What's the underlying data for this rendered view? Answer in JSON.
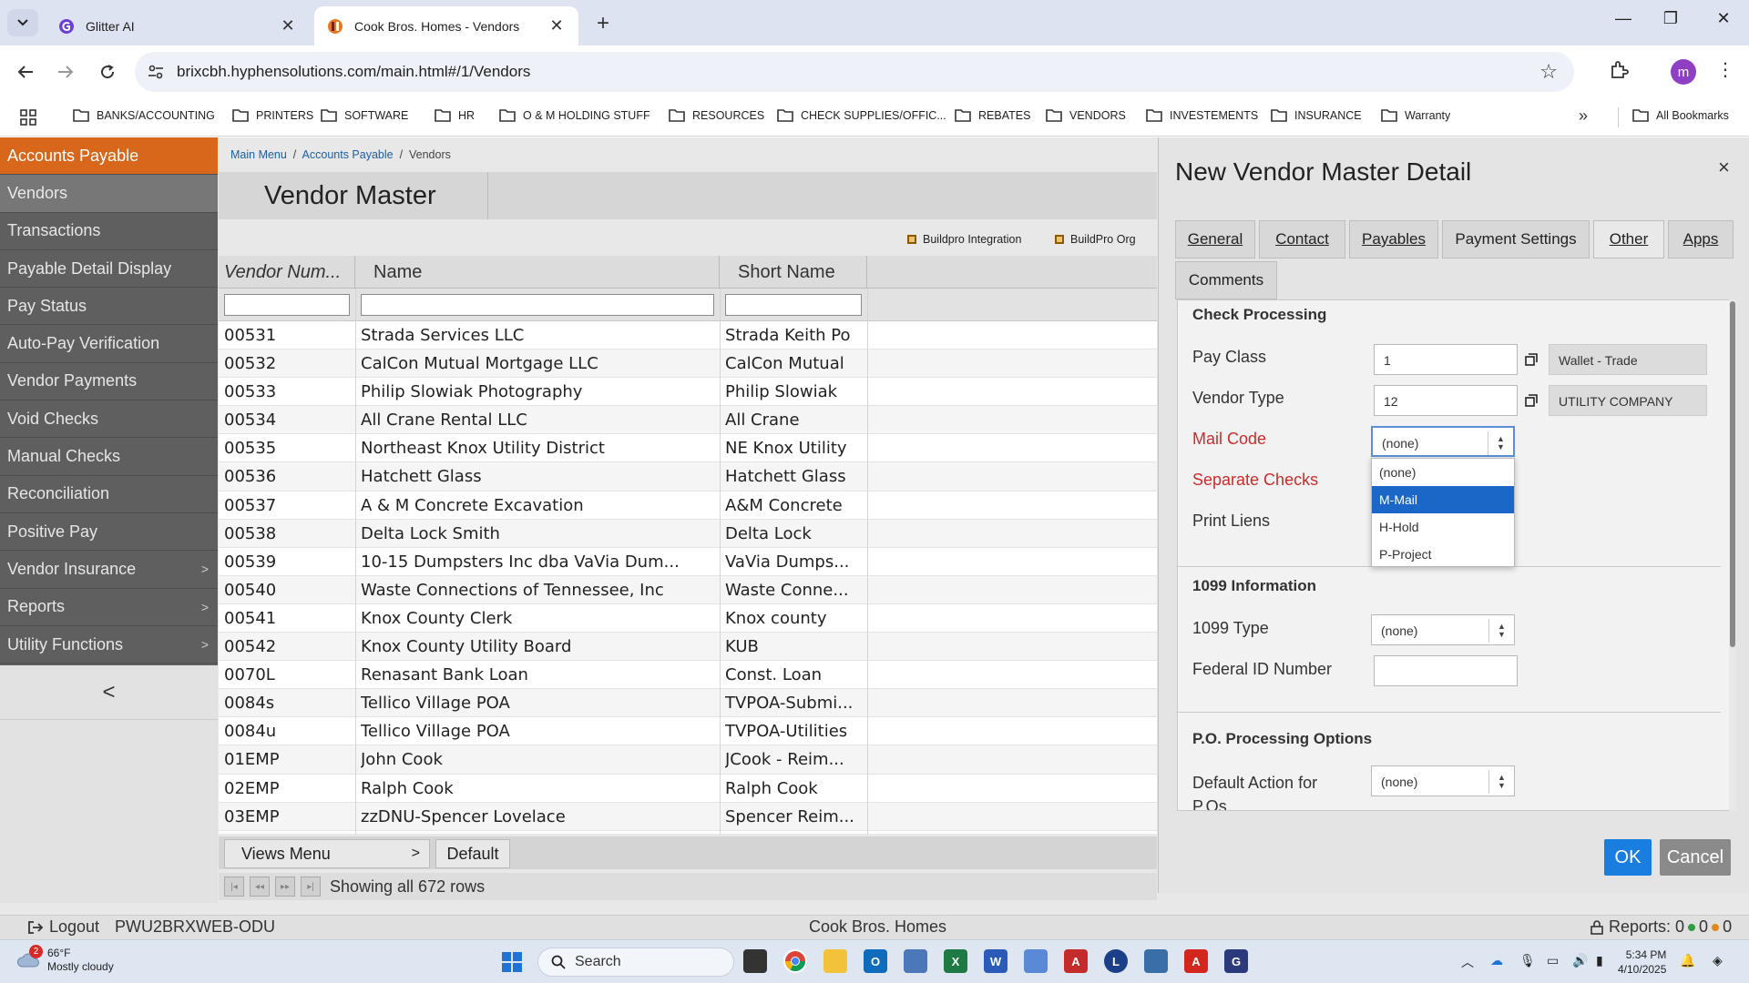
{
  "browser": {
    "tabs": [
      {
        "title": "Glitter AI",
        "active": false
      },
      {
        "title": "Cook Bros. Homes - Vendors",
        "active": true
      }
    ],
    "url": "brixcbh.hyphensolutions.com/main.html#/1/Vendors",
    "profile_initial": "m",
    "bookmarks": [
      "BANKS/ACCOUNTING",
      "PRINTERS",
      "SOFTWARE",
      "HR",
      "O & M HOLDING STUFF",
      "RESOURCES",
      "CHECK SUPPLIES/OFFIC...",
      "REBATES",
      "VENDORS",
      "INVESTEMENTS",
      "INSURANCE",
      "Warranty"
    ],
    "all_bookmarks": "All Bookmarks"
  },
  "sidebar": {
    "items": [
      {
        "label": "Accounts Payable",
        "state": "header"
      },
      {
        "label": "Vendors",
        "state": "selected"
      },
      {
        "label": "Transactions"
      },
      {
        "label": "Payable Detail Display"
      },
      {
        "label": "Pay Status"
      },
      {
        "label": "Auto-Pay Verification"
      },
      {
        "label": "Vendor Payments"
      },
      {
        "label": "Void Checks"
      },
      {
        "label": "Manual Checks"
      },
      {
        "label": "Reconciliation"
      },
      {
        "label": "Positive Pay"
      },
      {
        "label": "Vendor Insurance",
        "submenu": true
      },
      {
        "label": "Reports",
        "submenu": true
      },
      {
        "label": "Utility Functions",
        "submenu": true
      }
    ],
    "collapse_symbol": "<"
  },
  "breadcrumb": {
    "main_menu": "Main Menu",
    "accounts_payable": "Accounts Payable",
    "current": "Vendors",
    "sep": "/"
  },
  "page_title": "Vendor Master",
  "filters": {
    "buildpro_integration": "Buildpro Integration",
    "buildpro_org": "BuildPro Org"
  },
  "grid": {
    "columns": [
      "Vendor Num...",
      "Name",
      "Short Name"
    ],
    "rows": [
      [
        "00531",
        "Strada Services LLC",
        "Strada Keith Po"
      ],
      [
        "00532",
        "CalCon Mutual Mortgage LLC",
        "CalCon Mutual"
      ],
      [
        "00533",
        "Philip Slowiak Photography",
        "Philip Slowiak"
      ],
      [
        "00534",
        "All Crane Rental LLC",
        "All Crane"
      ],
      [
        "00535",
        "Northeast Knox Utility District",
        "NE Knox Utility"
      ],
      [
        "00536",
        "Hatchett Glass",
        "Hatchett Glass"
      ],
      [
        "00537",
        "A & M Concrete Excavation",
        "A&M Concrete"
      ],
      [
        "00538",
        "Delta Lock Smith",
        "Delta Lock"
      ],
      [
        "00539",
        "10-15 Dumpsters Inc dba VaVia Dum...",
        "VaVia Dumps..."
      ],
      [
        "00540",
        "Waste Connections of Tennessee, Inc",
        "Waste Conne..."
      ],
      [
        "00541",
        "Knox County Clerk",
        "Knox county"
      ],
      [
        "00542",
        "Knox County Utility Board",
        "KUB"
      ],
      [
        "0070L",
        "Renasant Bank Loan",
        "Const. Loan"
      ],
      [
        "0084s",
        "Tellico Village POA",
        "TVPOA-Submi..."
      ],
      [
        "0084u",
        "Tellico Village POA",
        "TVPOA-Utilities"
      ],
      [
        "01EMP",
        "John Cook",
        "JCook - Reim..."
      ],
      [
        "02EMP",
        "Ralph Cook",
        "Ralph Cook"
      ],
      [
        "03EMP",
        "zzDNU-Spencer Lovelace",
        "Spencer Reim..."
      ]
    ],
    "views_menu": "Views Menu",
    "default_view": "Default",
    "showing": "Showing all 672 rows"
  },
  "status": {
    "logout": "Logout",
    "server": "PWU2BRXWEB-ODU",
    "company": "Cook Bros. Homes",
    "reports": "Reports: 0",
    "reports_a": "0",
    "reports_b": "0",
    "colors": {
      "green": "#2e9e3e",
      "orange": "#e08a1e"
    }
  },
  "modal": {
    "title": "New Vendor Master Detail",
    "close": "×",
    "tabs": [
      "General",
      "Contact",
      "Payables",
      "Payment Settings",
      "Other",
      "Apps",
      "Comments"
    ],
    "active_tab": "Other",
    "check_processing": {
      "title": "Check Processing",
      "pay_class_label": "Pay Class",
      "pay_class_value": "1",
      "pay_class_desc": "Wallet - Trade",
      "vendor_type_label": "Vendor Type",
      "vendor_type_value": "12",
      "vendor_type_desc": "UTILITY COMPANY",
      "mail_code_label": "Mail Code",
      "mail_code_value": "(none)",
      "separate_checks_label": "Separate Checks",
      "print_liens_label": "Print Liens"
    },
    "mail_code_options": [
      "(none)",
      "M-Mail",
      "H-Hold",
      "P-Project"
    ],
    "mail_code_highlight": "M-Mail",
    "info_1099": {
      "title": "1099 Information",
      "type_label": "1099 Type",
      "type_value": "(none)",
      "fed_id_label": "Federal ID Number",
      "fed_id_value": ""
    },
    "po_options": {
      "title": "P.O. Processing Options",
      "default_action_label": "Default Action for P.Os",
      "default_action_value": "(none)"
    },
    "ok": "OK",
    "cancel": "Cancel"
  },
  "taskbar": {
    "weather_temp": "66°F",
    "weather_desc": "Mostly cloudy",
    "weather_badge": "2",
    "search": "Search",
    "time": "5:34 PM",
    "date": "4/10/2025"
  }
}
